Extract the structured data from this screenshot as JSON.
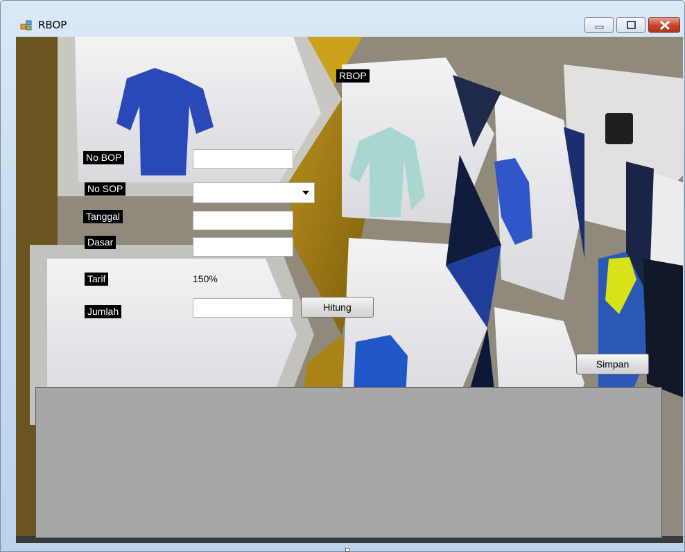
{
  "window": {
    "title": "RBOP",
    "icon": "winforms-app-icon"
  },
  "controls": {
    "minimize": "minimize-icon",
    "maximize": "maximize-icon",
    "close": "close-icon"
  },
  "form": {
    "heading": "RBOP",
    "labels": {
      "no_bop": "No BOP",
      "no_sop": "No SOP",
      "tanggal": "Tanggal",
      "dasar": "Dasar",
      "tarif": "Tarif",
      "jumlah": "Jumlah"
    },
    "fields": {
      "no_bop": "",
      "no_sop": "",
      "tanggal": "",
      "dasar": "",
      "jumlah": ""
    },
    "tarif_value": "150%",
    "buttons": {
      "hitung": "Hitung",
      "simpan": "Simpan"
    }
  },
  "colors": {
    "grid_background": "#a7a7a7",
    "label_background": "#000000",
    "label_text": "#ffffff"
  }
}
